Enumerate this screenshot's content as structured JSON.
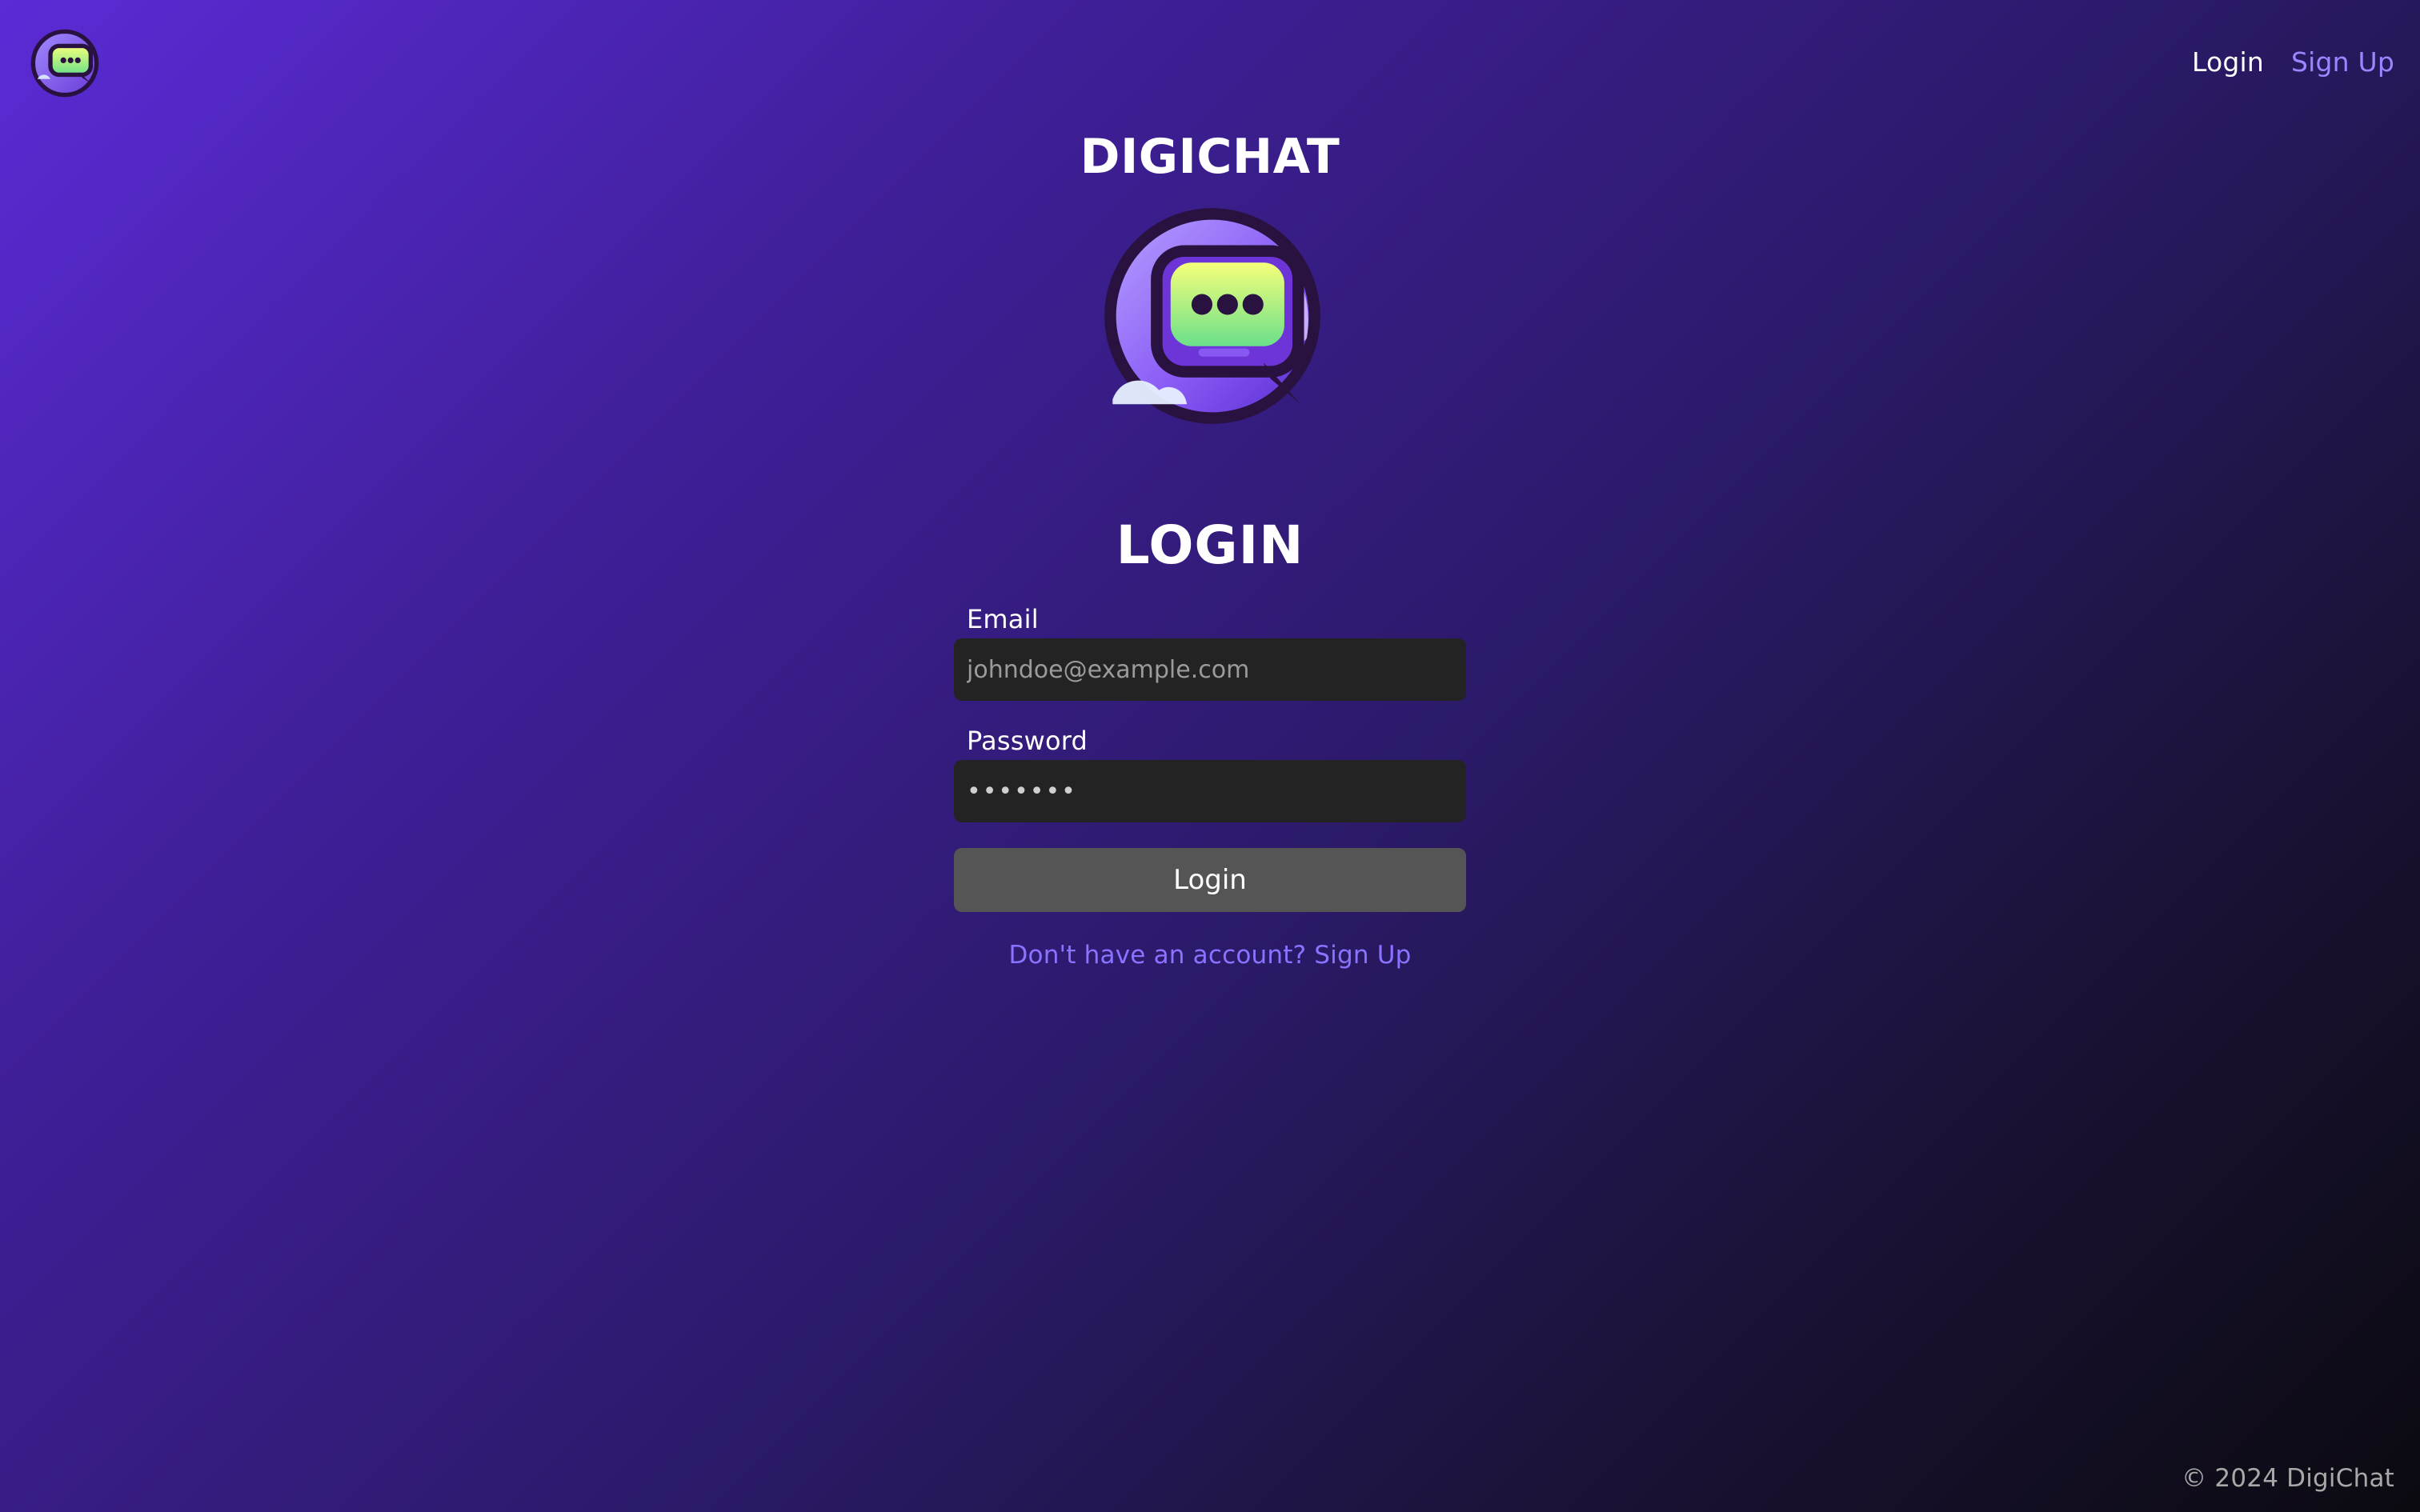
{
  "nav": {
    "login_label": "Login",
    "signup_label": "Sign Up"
  },
  "brand": {
    "title": "DIGICHAT"
  },
  "login": {
    "title": "LOGIN",
    "email_label": "Email",
    "email_placeholder": "johndoe@example.com",
    "email_value": "",
    "password_label": "Password",
    "password_value": "•••••••",
    "button_label": "Login",
    "signup_prompt": "Don't have an account? Sign Up"
  },
  "footer": {
    "text": "© 2024 DigiChat"
  },
  "icons": {
    "brand": "chat-bubble-logo-icon"
  },
  "colors": {
    "accent_link": "#8a73ff",
    "nav_signup": "#9b86ff",
    "input_bg": "#232323",
    "button_bg": "#555555"
  }
}
